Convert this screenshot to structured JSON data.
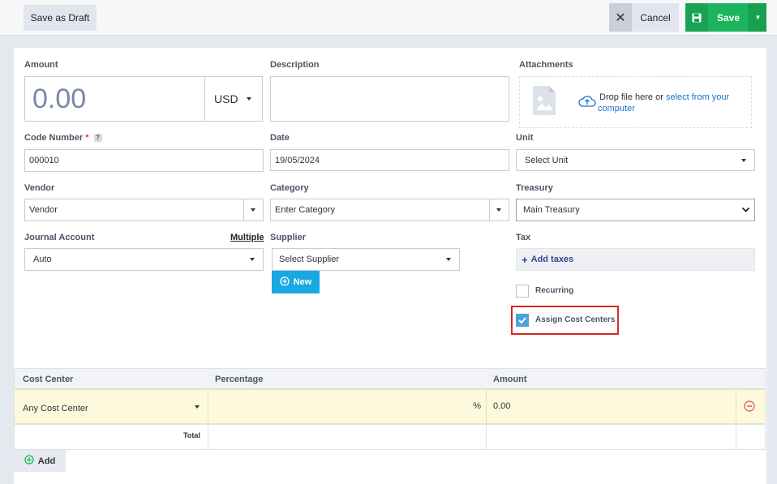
{
  "toolbar": {
    "save_draft_label": "Save as Draft",
    "cancel_label": "Cancel",
    "save_label": "Save"
  },
  "form": {
    "amount": {
      "label": "Amount",
      "value": "0.00",
      "currency": "USD"
    },
    "description": {
      "label": "Description",
      "value": ""
    },
    "attachments": {
      "label": "Attachments",
      "drop_text": "Drop file here or ",
      "select_link": "select from your",
      "select_link_2": "computer"
    },
    "code_number": {
      "label": "Code Number",
      "required_mark": "*",
      "help": "?",
      "value": "000010"
    },
    "date": {
      "label": "Date",
      "value": "19/05/2024"
    },
    "unit": {
      "label": "Unit",
      "value": "Select Unit"
    },
    "vendor": {
      "label": "Vendor",
      "value": "Vendor"
    },
    "category": {
      "label": "Category",
      "value": "Enter Category"
    },
    "treasury": {
      "label": "Treasury",
      "value": "Main Treasury"
    },
    "journal_account": {
      "label": "Journal Account",
      "multiple_link": "Multiple",
      "value": "Auto"
    },
    "supplier": {
      "label": "Supplier",
      "value": "Select Supplier",
      "new_button": "New"
    },
    "tax": {
      "label": "Tax",
      "add_label": "Add taxes"
    },
    "recurring": {
      "label": "Recurring",
      "checked": false
    },
    "assign_cost_centers": {
      "label": "Assign Cost Centers",
      "checked": true
    }
  },
  "cost_table": {
    "headers": [
      "Cost Center",
      "Percentage",
      "Amount"
    ],
    "rows": [
      {
        "cost_center": "Any Cost Center",
        "percentage": "",
        "percent_sign": "%",
        "amount": "0.00"
      }
    ],
    "total_label": "Total",
    "add_label": "Add"
  },
  "colors": {
    "save_green": "#1cb45c",
    "new_blue": "#1aa8e2",
    "highlight_red": "#d62828",
    "row_yellow": "#fdf9dc"
  }
}
